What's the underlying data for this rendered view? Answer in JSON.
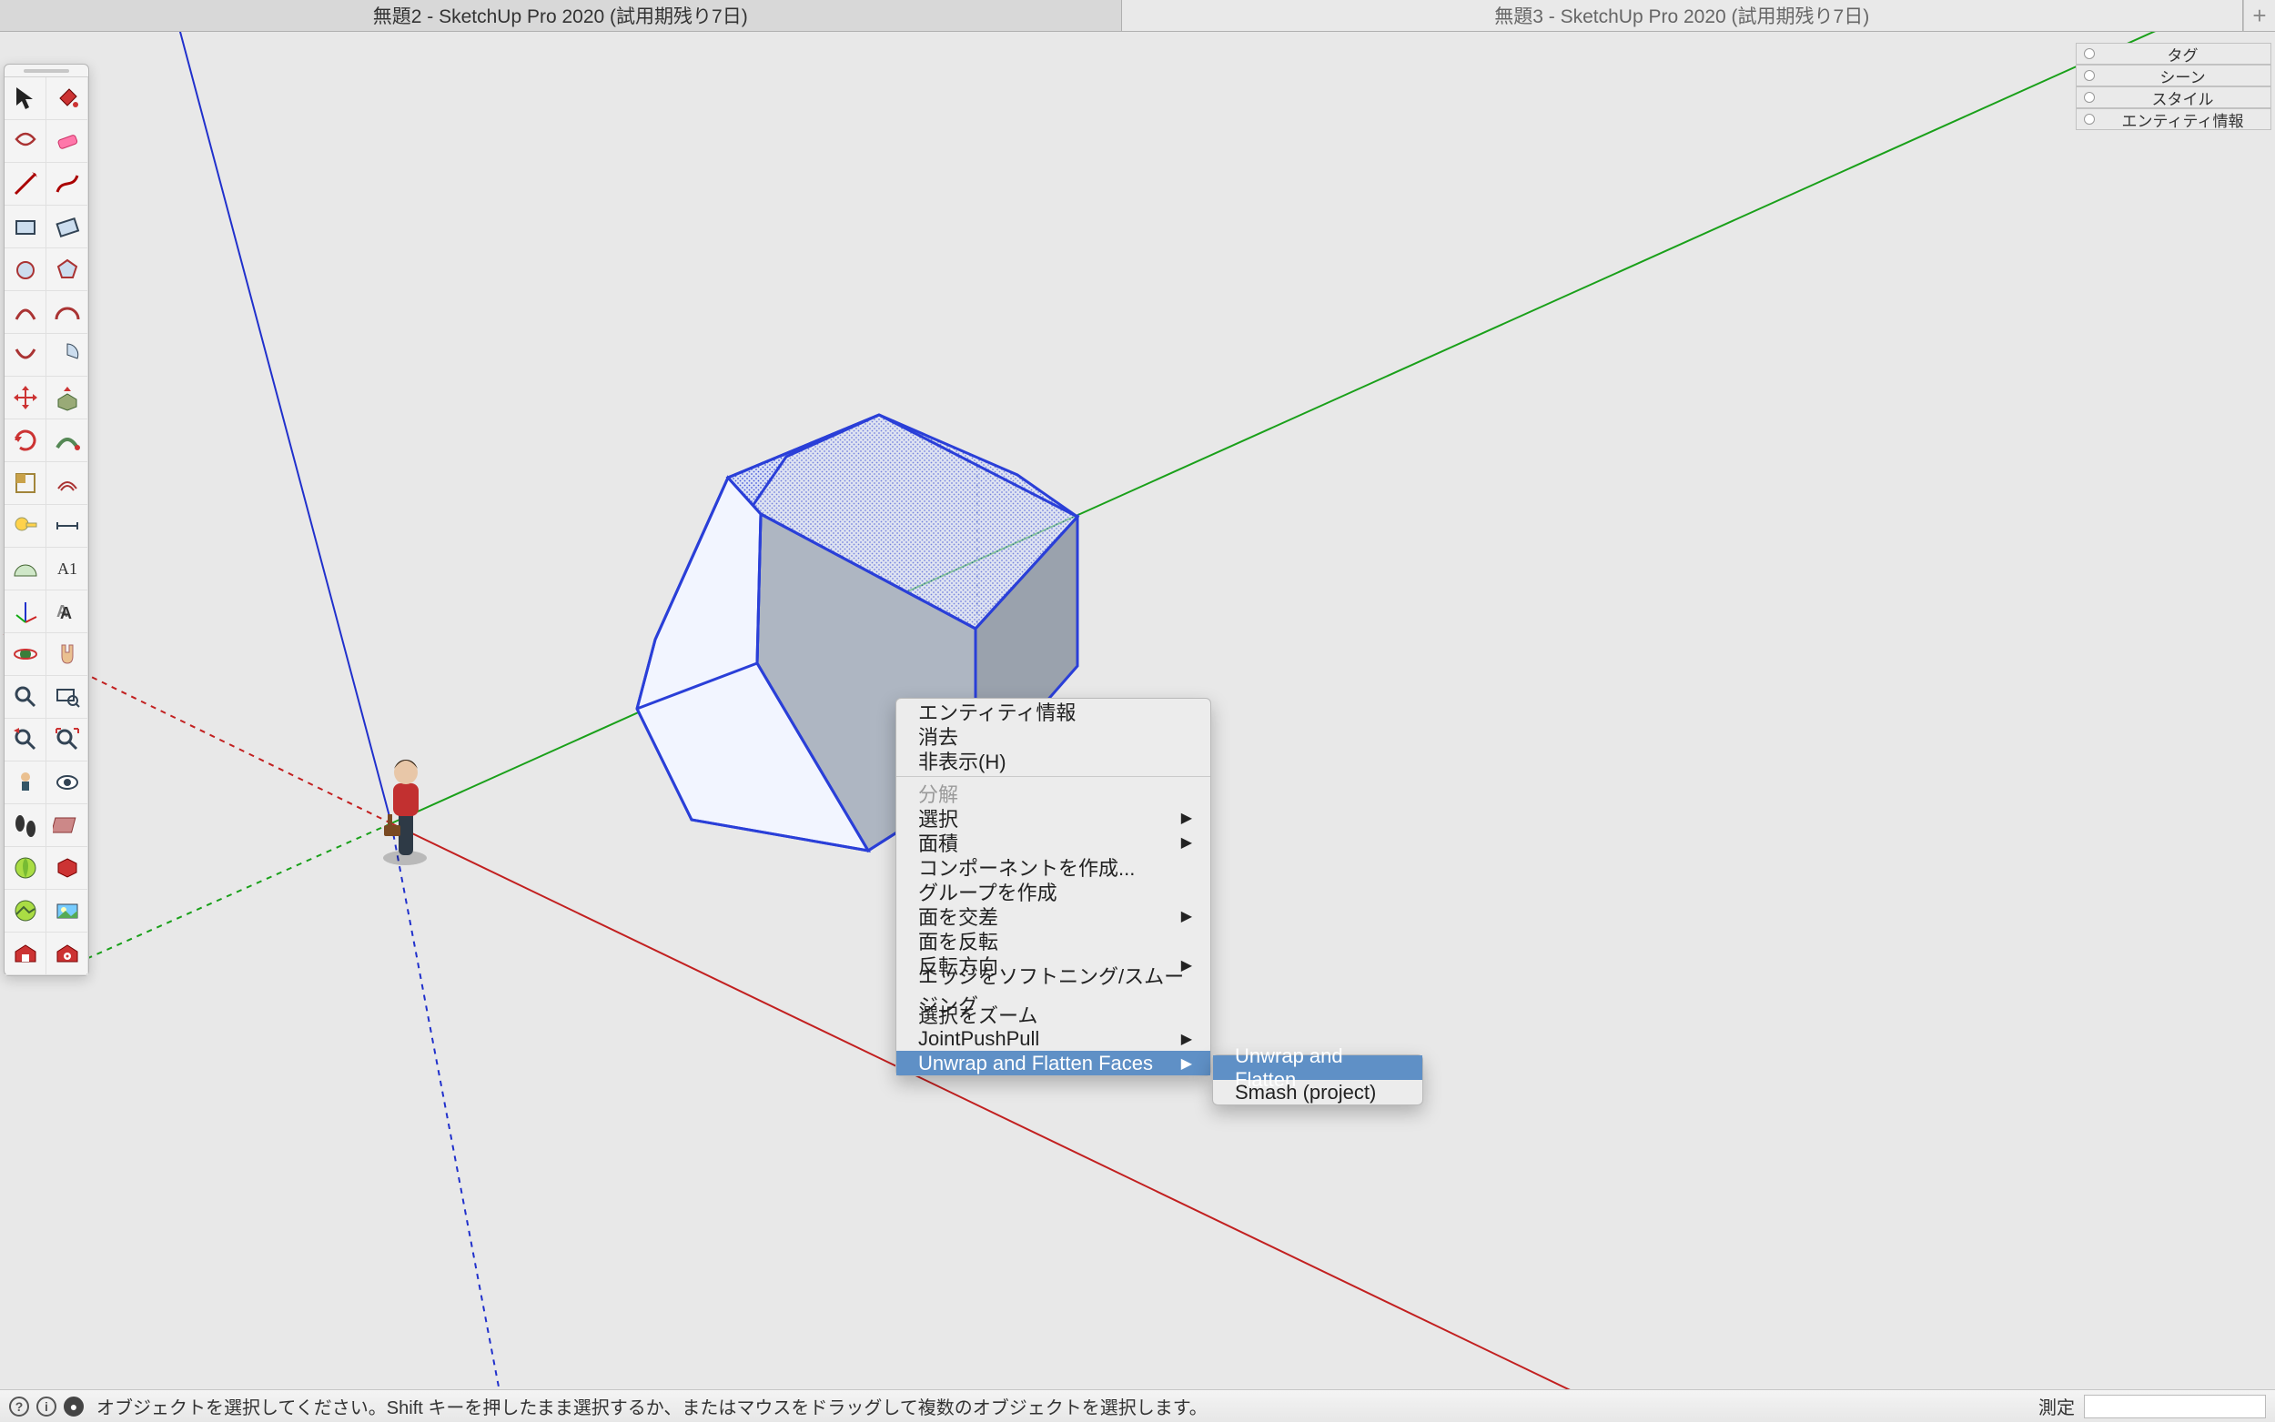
{
  "titlebar": {
    "tab1": "無題2 - SketchUp Pro 2020 (試用期残り7日)",
    "tab2": "無題3 - SketchUp Pro 2020 (試用期残り7日)",
    "new_tab_glyph": "+"
  },
  "tray": {
    "items": [
      {
        "label": "タグ"
      },
      {
        "label": "シーン"
      },
      {
        "label": "スタイル"
      },
      {
        "label": "エンティティ情報"
      }
    ]
  },
  "toolbar": {
    "rows": 21,
    "cols": 2,
    "tools": [
      "select-tool",
      "paint-bucket-tool",
      "lasso-select-tool",
      "eraser-tool",
      "line-tool",
      "freehand-tool",
      "rectangle-tool",
      "rotated-rectangle-tool",
      "circle-tool",
      "polygon-tool",
      "arc-tool",
      "two-point-arc-tool",
      "three-point-arc-tool",
      "pie-tool",
      "move-tool",
      "push-pull-tool",
      "rotate-tool",
      "follow-me-tool",
      "scale-tool",
      "offset-tool",
      "tape-measure-tool",
      "dimension-tool",
      "protractor-tool",
      "text-tool",
      "axes-tool",
      "3d-text-tool",
      "orbit-tool",
      "pan-tool",
      "zoom-tool",
      "zoom-window-tool",
      "previous-view-tool",
      "zoom-extents-tool",
      "position-camera-tool",
      "look-around-tool",
      "walk-tool",
      "section-plane-tool",
      "add-location-tool",
      "get-models-tool",
      "toggle-terrain-tool",
      "photo-textures-tool",
      "3d-warehouse-tool",
      "extension-warehouse-tool"
    ]
  },
  "context_menu": {
    "items": [
      {
        "label": "エンティティ情報",
        "submenu": false,
        "enabled": true
      },
      {
        "label": "消去",
        "submenu": false,
        "enabled": true
      },
      {
        "label": "非表示(H)",
        "submenu": false,
        "enabled": true
      },
      {
        "sep": true
      },
      {
        "label": "分解",
        "submenu": false,
        "enabled": false
      },
      {
        "label": "選択",
        "submenu": true,
        "enabled": true
      },
      {
        "label": "面積",
        "submenu": true,
        "enabled": true
      },
      {
        "label": "コンポーネントを作成...",
        "submenu": false,
        "enabled": true
      },
      {
        "label": "グループを作成",
        "submenu": false,
        "enabled": true
      },
      {
        "label": "面を交差",
        "submenu": true,
        "enabled": true
      },
      {
        "label": "面を反転",
        "submenu": false,
        "enabled": true
      },
      {
        "label": "反転方向",
        "submenu": true,
        "enabled": true
      },
      {
        "label": "エッジをソフトニング/スムージング",
        "submenu": false,
        "enabled": true
      },
      {
        "label": "選択をズーム",
        "submenu": false,
        "enabled": true
      },
      {
        "label": "JointPushPull",
        "submenu": true,
        "enabled": true
      },
      {
        "label": "Unwrap and Flatten Faces",
        "submenu": true,
        "enabled": true,
        "hover": true
      }
    ],
    "submenu_unwrap": [
      {
        "label": "Unwrap and Flatten",
        "hover": true
      },
      {
        "label": "Smash (project)",
        "hover": false
      }
    ]
  },
  "statusbar": {
    "geo_q": "?",
    "geo_i": "i",
    "person": "●",
    "hint": "オブジェクトを選択してください。Shift キーを押したまま選択するか、またはマウスをドラッグして複数のオブジェクトを選択します。",
    "measure_label": "測定"
  },
  "colors": {
    "axis_red": "#c22020",
    "axis_green": "#1aa01a",
    "axis_blue": "#2030cc",
    "selection_blue": "#2a3fd8",
    "grey_face": "#9aa2ad"
  }
}
